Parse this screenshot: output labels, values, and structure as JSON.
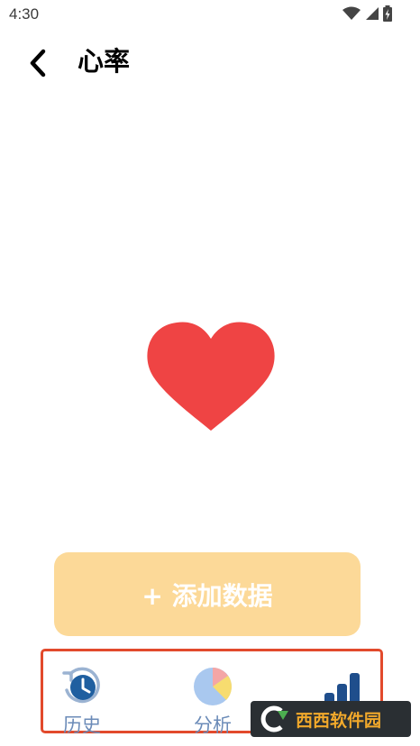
{
  "status_bar": {
    "time": "4:30",
    "icons": [
      "wifi-icon",
      "signal-icon",
      "battery-icon"
    ]
  },
  "app_bar": {
    "title": "心率",
    "back_icon": "chevron-left-icon"
  },
  "main": {
    "heart_icon": "heart-icon",
    "heart_color": "#ef4444"
  },
  "add_button": {
    "label": "+ 添加数据",
    "background": "#fcd998"
  },
  "bottom_nav": {
    "items": [
      {
        "label": "历史",
        "icon": "history-icon"
      },
      {
        "label": "分析",
        "icon": "pie-chart-icon"
      },
      {
        "label": "",
        "icon": "bar-chart-icon"
      }
    ],
    "highlight_color": "#e24a2c"
  },
  "watermark": {
    "text": "西西软件园"
  }
}
